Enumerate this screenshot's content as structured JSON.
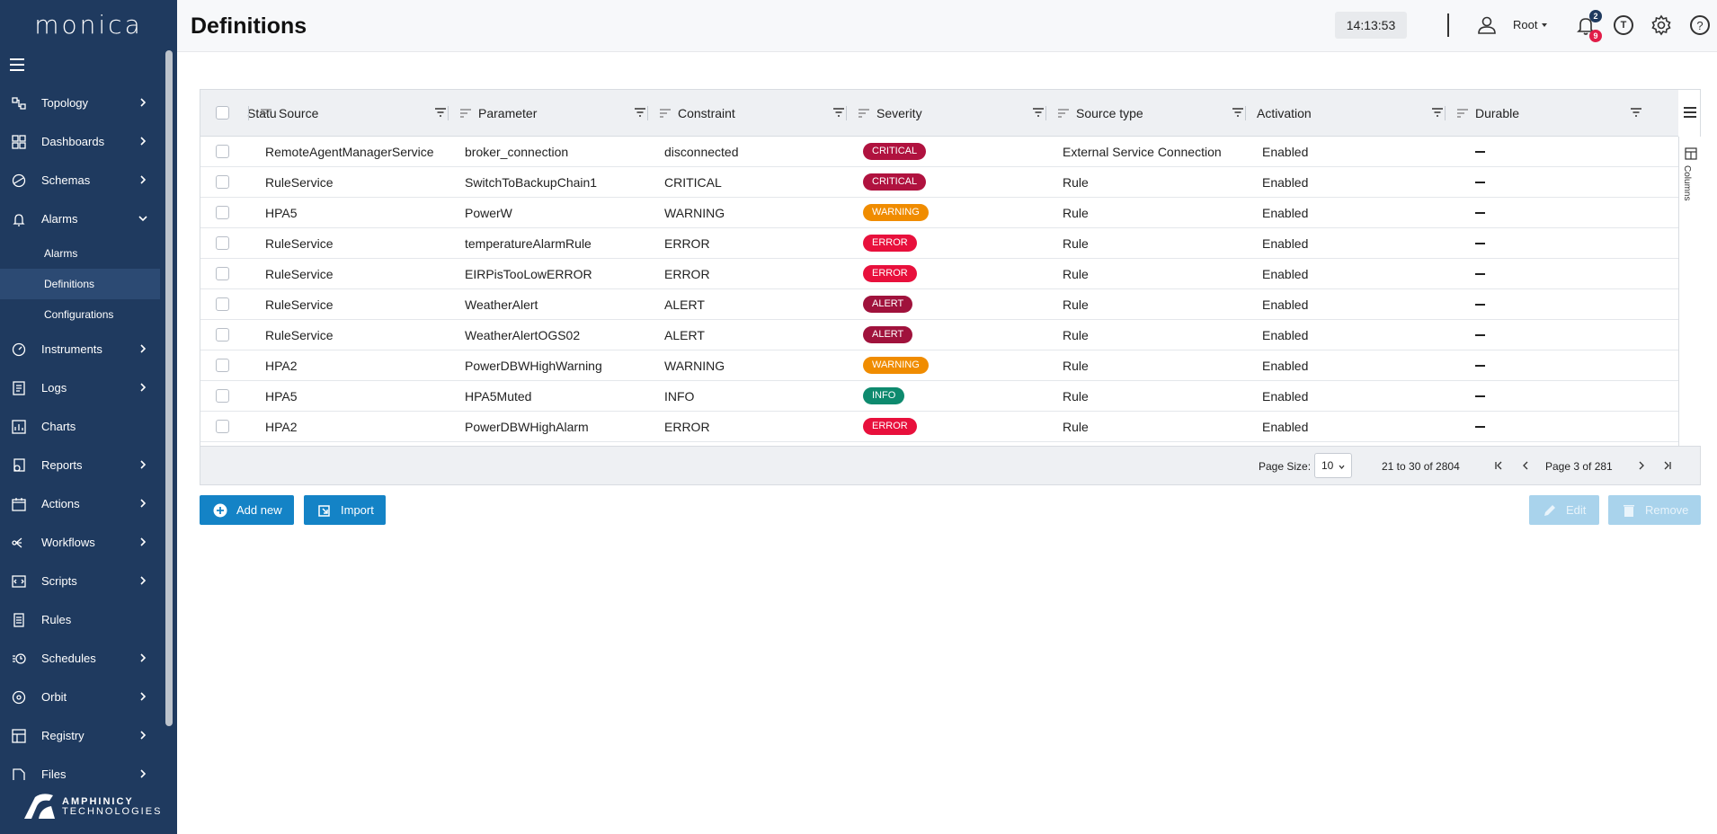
{
  "app": {
    "logo_text": "monica",
    "brand_line1": "AMPHINICY",
    "brand_line2": "TECHNOLOGIES"
  },
  "header": {
    "title": "Definitions",
    "clock": "14:13:53",
    "user": "Root",
    "notif_count_top": "2",
    "notif_count_bottom": "9",
    "t_icon_label": "T",
    "help_label": "?"
  },
  "sidebar": {
    "items": [
      {
        "label": "Topology",
        "icon": "topology-icon",
        "chevron": "right"
      },
      {
        "label": "Dashboards",
        "icon": "dashboards-icon",
        "chevron": "right"
      },
      {
        "label": "Schemas",
        "icon": "schemas-icon",
        "chevron": "right"
      },
      {
        "label": "Alarms",
        "icon": "bell-icon",
        "chevron": "down"
      },
      {
        "label": "Instruments",
        "icon": "instruments-icon",
        "chevron": "right"
      },
      {
        "label": "Logs",
        "icon": "logs-icon",
        "chevron": "right"
      },
      {
        "label": "Charts",
        "icon": "charts-icon",
        "chevron": ""
      },
      {
        "label": "Reports",
        "icon": "reports-icon",
        "chevron": "right"
      },
      {
        "label": "Actions",
        "icon": "actions-icon",
        "chevron": "right"
      },
      {
        "label": "Workflows",
        "icon": "workflows-icon",
        "chevron": "right"
      },
      {
        "label": "Scripts",
        "icon": "scripts-icon",
        "chevron": "right"
      },
      {
        "label": "Rules",
        "icon": "rules-icon",
        "chevron": ""
      },
      {
        "label": "Schedules",
        "icon": "schedules-icon",
        "chevron": "right"
      },
      {
        "label": "Orbit",
        "icon": "orbit-icon",
        "chevron": "right"
      },
      {
        "label": "Registry",
        "icon": "registry-icon",
        "chevron": "right"
      },
      {
        "label": "Files",
        "icon": "files-icon",
        "chevron": "right"
      }
    ],
    "alarms_sub": [
      "Alarms",
      "Definitions",
      "Configurations"
    ],
    "active_sub": "Definitions"
  },
  "table": {
    "columns": [
      "Statu",
      "Source",
      "Parameter",
      "Constraint",
      "Severity",
      "Source type",
      "Activation",
      "Durable"
    ],
    "side_panel_label": "Columns",
    "rows": [
      {
        "source": "RemoteAgentManagerService",
        "parameter": "broker_connection",
        "constraint": "disconnected",
        "severity": "CRITICAL",
        "source_type": "External Service Connection",
        "activation": "Enabled"
      },
      {
        "source": "RuleService",
        "parameter": "SwitchToBackupChain1",
        "constraint": "CRITICAL",
        "severity": "CRITICAL",
        "source_type": "Rule",
        "activation": "Enabled"
      },
      {
        "source": "HPA5",
        "parameter": "PowerW",
        "constraint": "WARNING",
        "severity": "WARNING",
        "source_type": "Rule",
        "activation": "Enabled"
      },
      {
        "source": "RuleService",
        "parameter": "temperatureAlarmRule",
        "constraint": "ERROR",
        "severity": "ERROR",
        "source_type": "Rule",
        "activation": "Enabled"
      },
      {
        "source": "RuleService",
        "parameter": "EIRPisTooLowERROR",
        "constraint": "ERROR",
        "severity": "ERROR",
        "source_type": "Rule",
        "activation": "Enabled"
      },
      {
        "source": "RuleService",
        "parameter": "WeatherAlert",
        "constraint": "ALERT",
        "severity": "ALERT",
        "source_type": "Rule",
        "activation": "Enabled"
      },
      {
        "source": "RuleService",
        "parameter": "WeatherAlertOGS02",
        "constraint": "ALERT",
        "severity": "ALERT",
        "source_type": "Rule",
        "activation": "Enabled"
      },
      {
        "source": "HPA2",
        "parameter": "PowerDBWHighWarning",
        "constraint": "WARNING",
        "severity": "WARNING",
        "source_type": "Rule",
        "activation": "Enabled"
      },
      {
        "source": "HPA5",
        "parameter": "HPA5Muted",
        "constraint": "INFO",
        "severity": "INFO",
        "source_type": "Rule",
        "activation": "Enabled"
      },
      {
        "source": "HPA2",
        "parameter": "PowerDBWHighAlarm",
        "constraint": "ERROR",
        "severity": "ERROR",
        "source_type": "Rule",
        "activation": "Enabled"
      }
    ],
    "severity_colors": {
      "CRITICAL": "#b0123f",
      "WARNING": "#f08c00",
      "ERROR": "#e8103c",
      "ALERT": "#a0123c",
      "INFO": "#0e8a6e"
    }
  },
  "pagination": {
    "page_size_label": "Page Size:",
    "page_size": "10",
    "range": "21 to 30 of 2804",
    "page_text": "Page 3 of 281"
  },
  "actions": {
    "add_new": "Add new",
    "import": "Import",
    "edit": "Edit",
    "remove": "Remove"
  },
  "colors": {
    "sidebar_bg": "#1f3a5f",
    "primary_button": "#1483c6"
  }
}
